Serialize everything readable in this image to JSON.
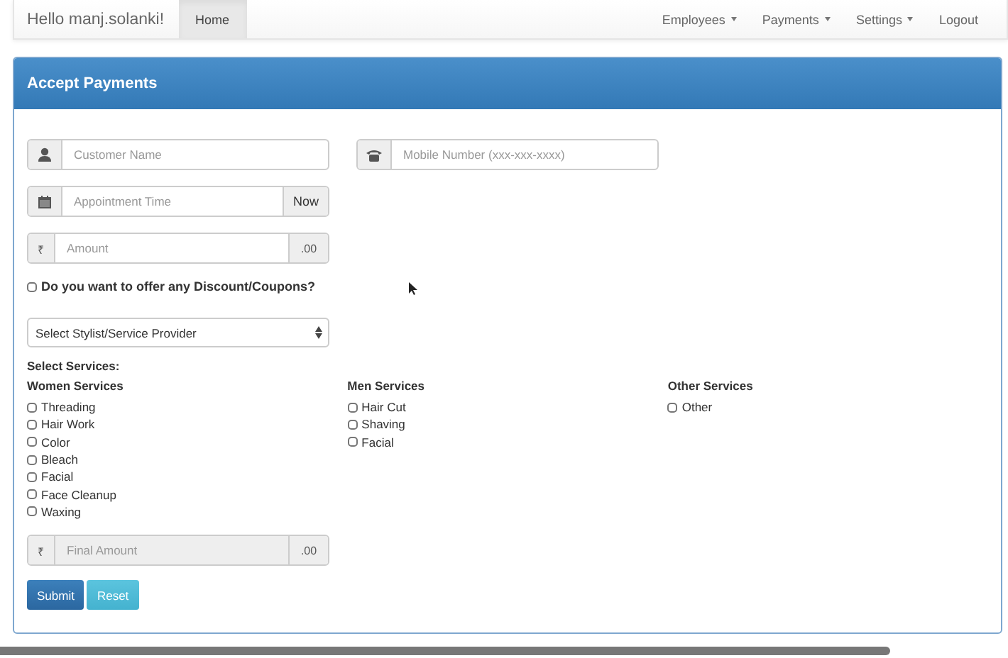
{
  "navbar": {
    "brand": "Hello manj.solanki!",
    "left_items": [
      {
        "label": "Home",
        "selected": true
      }
    ],
    "right_items": [
      {
        "label": "Employees",
        "dropdown": true
      },
      {
        "label": "Payments",
        "dropdown": true
      },
      {
        "label": "Settings",
        "dropdown": true
      },
      {
        "label": "Logout",
        "dropdown": false
      }
    ]
  },
  "panel": {
    "title": "Accept Payments",
    "field_rows": [
      [
        {
          "kind": "person",
          "placeholder": "Customer Name",
          "disabled": false
        },
        {
          "kind": "phone",
          "placeholder": "Mobile Number (xxx-xxx-xxxx)",
          "disabled": false
        }
      ],
      [
        {
          "kind": "calendar",
          "placeholder": "Appointment Time",
          "button": "Now",
          "disabled": false
        }
      ],
      [
        {
          "kind": "currency",
          "addon_text": "₹",
          "placeholder": "Amount",
          "suffix": ".00",
          "disabled": false
        }
      ]
    ],
    "discount": {
      "label": "Do you want to offer any Discount/Coupons?",
      "checked": false
    },
    "stylist_select": {
      "value": "Select Stylist/Service Provider"
    },
    "services_label": "Select Services:",
    "service_groups": [
      {
        "title": "Women Services",
        "items": [
          {
            "label": "Threading",
            "checked": false
          },
          {
            "label": "Hair Work",
            "checked": false
          },
          {
            "label": "Color",
            "checked": false
          },
          {
            "label": "Bleach",
            "checked": false
          },
          {
            "label": "Facial",
            "checked": false
          },
          {
            "label": "Face Cleanup",
            "checked": false
          },
          {
            "label": "Waxing",
            "checked": false
          }
        ]
      },
      {
        "title": "Men Services",
        "items": [
          {
            "label": "Hair Cut",
            "checked": false
          },
          {
            "label": "Shaving",
            "checked": false
          },
          {
            "label": "Facial",
            "checked": false
          }
        ]
      },
      {
        "title": "Other Services",
        "items": [
          {
            "label": "Other",
            "checked": false
          }
        ]
      }
    ],
    "final_amount": {
      "kind": "currency",
      "addon_text": "₹",
      "placeholder": "Final Amount",
      "suffix": ".00",
      "disabled": true
    },
    "buttons": [
      {
        "label": "Submit",
        "kind": "primary"
      },
      {
        "label": "Reset",
        "kind": "info"
      }
    ]
  }
}
